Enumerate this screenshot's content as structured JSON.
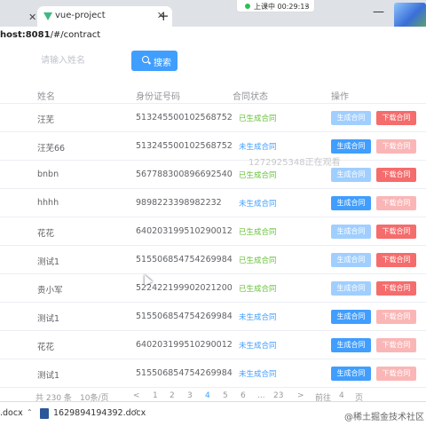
{
  "browser": {
    "prev_tab_close": "✕",
    "tab_title": "vue-project",
    "tab_close": "✕",
    "new_tab": "+",
    "meeting_status": "上课中 00:29:13",
    "meeting_chevron": "⌄",
    "minimize": "—",
    "url_host": "host:8081",
    "url_path": "/#/contract"
  },
  "search": {
    "placeholder": "请输入姓名",
    "button_label": "搜索"
  },
  "table": {
    "headers": [
      "姓名",
      "身份证号码",
      "合同状态",
      "操作"
    ],
    "generate_label": "生成合同",
    "download_label": "下载合同",
    "rows": [
      {
        "name": "汪芜",
        "id": "513245500102568752",
        "status": "已生成合同"
      },
      {
        "name": "汪芜66",
        "id": "513245500102568752",
        "status": "未生成合同"
      },
      {
        "name": "bnbn",
        "id": "567788300896692540",
        "status": "已生成合同"
      },
      {
        "name": "hhhh",
        "id": "9898223398982232",
        "status": "未生成合同"
      },
      {
        "name": "花花",
        "id": "640203199510290012",
        "status": "已生成合同"
      },
      {
        "name": "测试1",
        "id": "515506854754269984",
        "status": "已生成合同"
      },
      {
        "name": "贵小军",
        "id": "522422199902021200",
        "status": "已生成合同"
      },
      {
        "name": "测试1",
        "id": "515506854754269984",
        "status": "未生成合同"
      },
      {
        "name": "花花",
        "id": "640203199510290012",
        "status": "未生成合同"
      },
      {
        "name": "测试1",
        "id": "515506854754269984",
        "status": "未生成合同"
      }
    ]
  },
  "watermark": "1272925348正在观看",
  "pagination": {
    "total": "共 230 条",
    "page_size": "10条/页",
    "prev": "<",
    "pages": [
      "1",
      "2",
      "3",
      "4",
      "5",
      "6",
      "...",
      "23"
    ],
    "active_page": "4",
    "next": ">",
    "goto_label": "前往",
    "goto_value": "4",
    "goto_suffix": "页"
  },
  "downloads": {
    "file_partial": ".docx",
    "file_name": "1629894194392.docx",
    "chevron": "⌃"
  },
  "credit": "@稀土掘金技术社区",
  "colors": {
    "primary": "#409eff",
    "danger": "#f56c6c",
    "success": "#67c23a"
  }
}
